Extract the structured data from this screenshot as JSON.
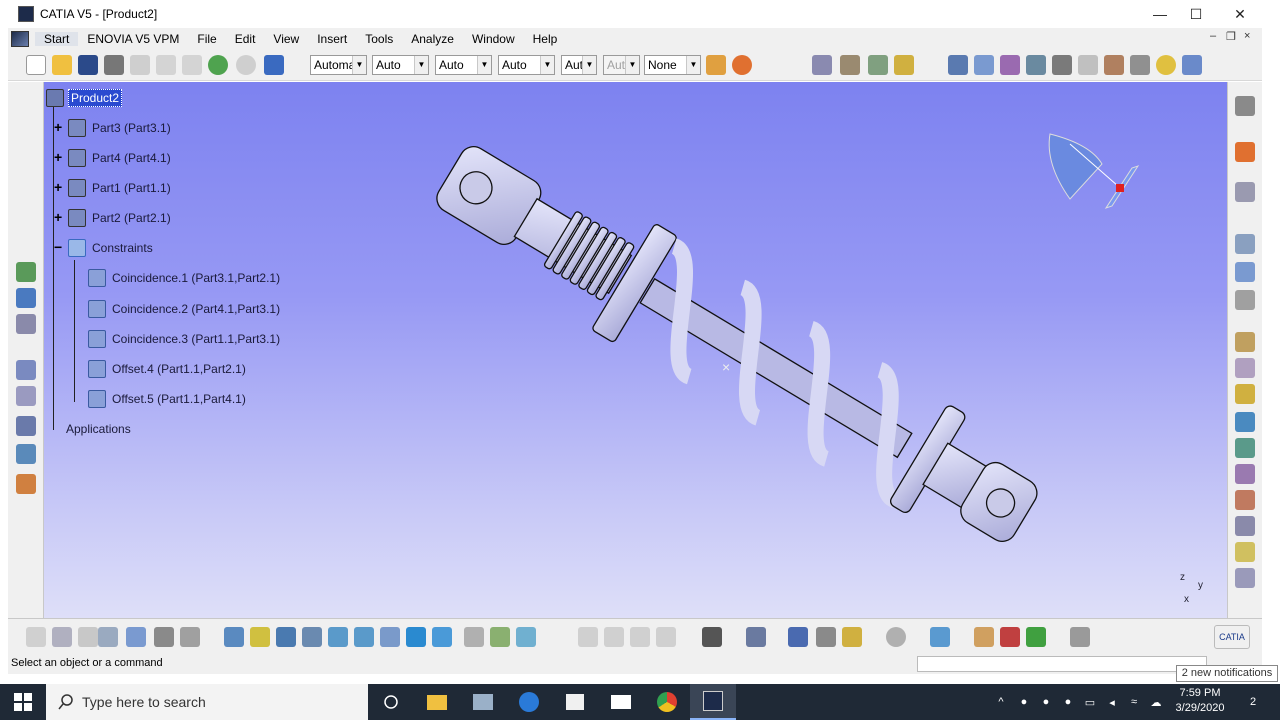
{
  "window": {
    "title": "CATIA V5 - [Product2]",
    "minimize": "—",
    "maximize": "☐",
    "close": "✕"
  },
  "menu": {
    "items": [
      "Start",
      "ENOVIA V5 VPM",
      "File",
      "Edit",
      "View",
      "Insert",
      "Tools",
      "Analyze",
      "Window",
      "Help"
    ],
    "doc_minimize": "–",
    "doc_restore": "❐",
    "doc_close": "×"
  },
  "toolbar": {
    "combo1": "Automa",
    "combo2": "Auto",
    "combo3": "Auto",
    "combo4": "Auto",
    "combo5": "Aut",
    "combo6": "Aut",
    "combo7": "None"
  },
  "tree": {
    "root": "Product2",
    "parts": [
      "Part3 (Part3.1)",
      "Part4 (Part4.1)",
      "Part1 (Part1.1)",
      "Part2 (Part2.1)"
    ],
    "constraints_label": "Constraints",
    "constraints": [
      "Coincidence.1 (Part3.1,Part2.1)",
      "Coincidence.2 (Part4.1,Part3.1)",
      "Coincidence.3 (Part1.1,Part3.1)",
      "Offset.4 (Part1.1,Part2.1)",
      "Offset.5 (Part1.1,Part4.1)"
    ],
    "applications": "Applications"
  },
  "axis_labels": {
    "z": "z",
    "y": "y",
    "x": "x"
  },
  "status": {
    "message": "Select an object or a command"
  },
  "notification": "2 new notifications",
  "taskbar": {
    "search_placeholder": "Type here to search",
    "time": "7:59 PM",
    "date": "3/29/2020",
    "notif_count": "2"
  },
  "colors": {
    "viewport_top": "#7d82f0",
    "viewport_bottom": "#dedff8",
    "part_fill": "#c8c9ea",
    "selection": "#2a4ad0"
  }
}
